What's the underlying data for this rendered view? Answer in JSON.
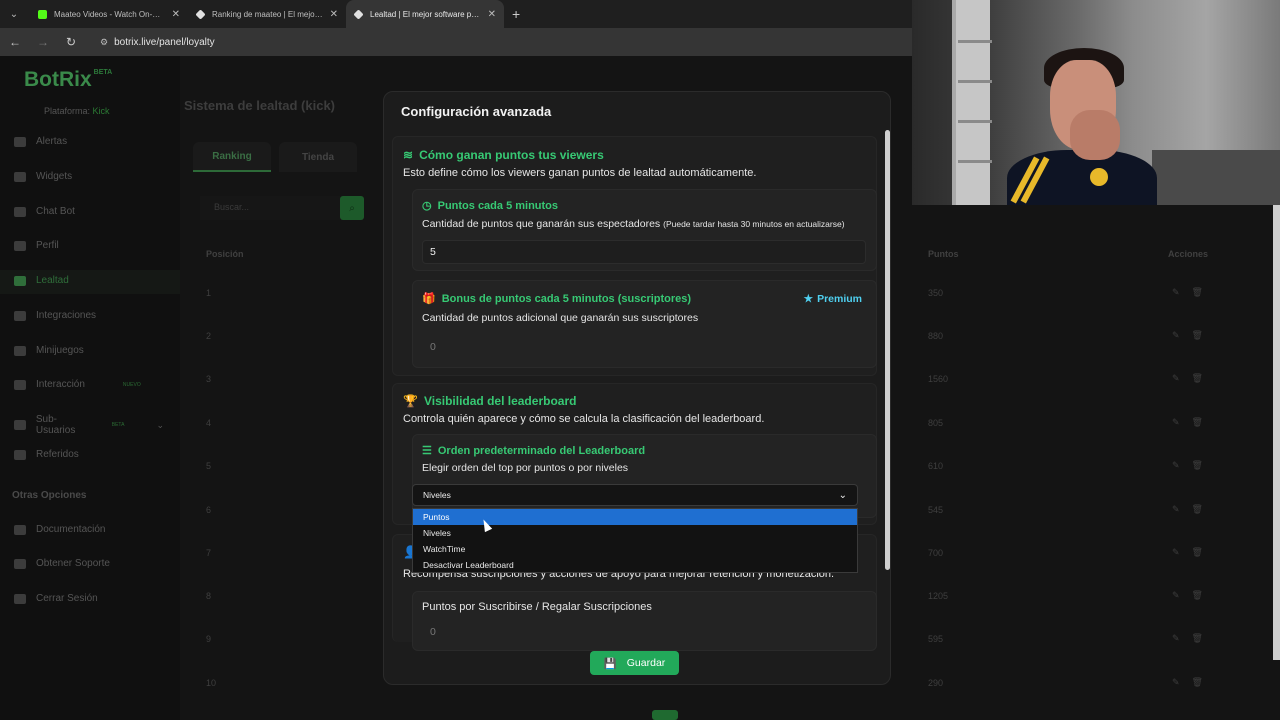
{
  "browser": {
    "tabs": [
      {
        "title": "Maateo Videos - Watch On-Dem",
        "favicon_color": "#53fc18"
      },
      {
        "title": "Ranking de maateo | El mejor s",
        "favicon_color": "#e0e0e0"
      },
      {
        "title": "Lealtad | El mejor software para",
        "favicon_color": "#e0e0e0"
      }
    ],
    "url": "botrix.live/panel/loyalty"
  },
  "sidebar": {
    "logo": "BotRix",
    "logo_badge": "BETA",
    "platform_label": "Plataforma:",
    "platform_value": "Kick",
    "items": [
      {
        "label": "Alertas"
      },
      {
        "label": "Widgets"
      },
      {
        "label": "Chat Bot"
      },
      {
        "label": "Perfil"
      },
      {
        "label": "Lealtad"
      },
      {
        "label": "Integraciones"
      },
      {
        "label": "Minijuegos"
      },
      {
        "label": "Interacción",
        "badge": "NUEVO"
      },
      {
        "label": "Sub-Usuarios",
        "badge": "BETA"
      },
      {
        "label": "Referidos"
      }
    ],
    "section": "Otras Opciones",
    "other_items": [
      {
        "label": "Documentación"
      },
      {
        "label": "Obtener Soporte"
      },
      {
        "label": "Cerrar Sesión"
      }
    ]
  },
  "background": {
    "title": "Sistema de lealtad (kick)",
    "tabs": [
      "Ranking",
      "Tienda"
    ],
    "search_placeholder": "Buscar...",
    "columns": {
      "position": "Posición",
      "points": "Puntos",
      "actions": "Acciones"
    },
    "rows": [
      {
        "pos": "1",
        "points": "350"
      },
      {
        "pos": "2",
        "points": "880"
      },
      {
        "pos": "3",
        "points": "1560"
      },
      {
        "pos": "4",
        "points": "805"
      },
      {
        "pos": "5",
        "points": "610"
      },
      {
        "pos": "6",
        "points": "545"
      },
      {
        "pos": "7",
        "points": "700"
      },
      {
        "pos": "8",
        "points": "1205"
      },
      {
        "pos": "9",
        "points": "595"
      },
      {
        "pos": "10",
        "points": "290"
      }
    ]
  },
  "modal": {
    "title": "Configuración avanzada",
    "earn": {
      "title": "Cómo ganan puntos tus viewers",
      "desc": "Esto define cómo los viewers ganan puntos de lealtad automáticamente.",
      "per5": {
        "title": "Puntos cada 5 minutos",
        "desc": "Cantidad de puntos que ganarán sus espectadores",
        "note": "(Puede tardar hasta 30 minutos en actualizarse)",
        "value": "5"
      },
      "bonus": {
        "title": "Bonus de puntos cada 5 minutos (suscriptores)",
        "premium": "Premium",
        "desc": "Cantidad de puntos adicional que ganarán sus suscriptores",
        "value": "0"
      }
    },
    "leaderboard": {
      "title": "Visibilidad del leaderboard",
      "desc": "Controla quién aparece y cómo se calcula la clasificación del leaderboard.",
      "order": {
        "title": "Orden predeterminado del Leaderboard",
        "desc": "Elegir orden del top por puntos o por niveles",
        "selected": "Niveles",
        "options": [
          "Puntos",
          "Niveles",
          "WatchTime",
          "Desactivar Leaderboard"
        ]
      }
    },
    "support": {
      "desc": "Recompensa suscripciones y acciones de apoyo para mejorar retención y monetización.",
      "subs_title": "Puntos por Suscribirse / Regalar Suscripciones",
      "subs_value": "0"
    },
    "save_label": "Guardar"
  },
  "colors": {
    "accent": "#37c974",
    "premium": "#4fd0f0",
    "highlight": "#1f6fd1",
    "save": "#22a95a"
  }
}
